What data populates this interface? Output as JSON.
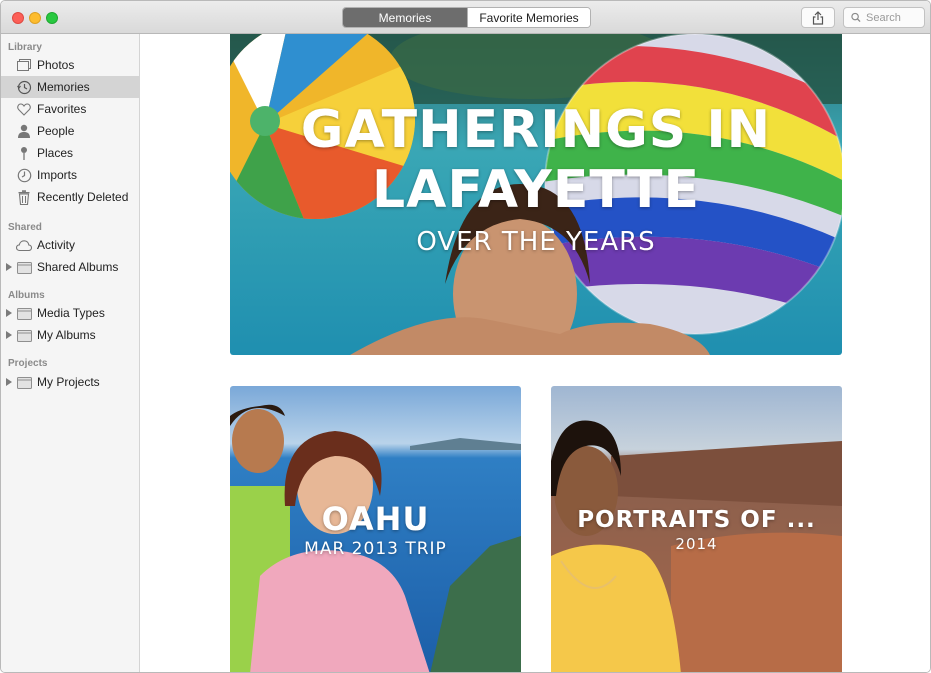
{
  "toolbar": {
    "tabs": [
      {
        "label": "Memories",
        "selected": true
      },
      {
        "label": "Favorite Memories",
        "selected": false
      }
    ],
    "search_placeholder": "Search",
    "share_icon": "share-icon"
  },
  "sidebar": {
    "sections": {
      "library": "Library",
      "shared": "Shared",
      "albums": "Albums",
      "projects": "Projects"
    },
    "items": [
      {
        "label": "Photos",
        "icon": "photos-icon"
      },
      {
        "label": "Memories",
        "icon": "memories-icon",
        "selected": true
      },
      {
        "label": "Favorites",
        "icon": "heart-icon"
      },
      {
        "label": "People",
        "icon": "person-icon"
      },
      {
        "label": "Places",
        "icon": "pin-icon"
      },
      {
        "label": "Imports",
        "icon": "clock-icon"
      },
      {
        "label": "Recently Deleted",
        "icon": "trash-icon"
      },
      {
        "label": "Activity",
        "icon": "cloud-icon"
      },
      {
        "label": "Shared Albums",
        "icon": "folder-icon"
      },
      {
        "label": "Media Types",
        "icon": "folder-icon"
      },
      {
        "label": "My Albums",
        "icon": "folder-icon"
      },
      {
        "label": "My Projects",
        "icon": "folder-icon"
      }
    ]
  },
  "memories": [
    {
      "title_line1": "Gatherings in",
      "title_line2": "Lafayette",
      "subtitle": "OVER THE YEARS"
    },
    {
      "title": "OAHU",
      "subtitle": "MAR 2013 TRIP"
    },
    {
      "title": "PORTRAITS OF ...",
      "subtitle": "2014"
    }
  ],
  "colors": {
    "accent_selected_tab": "#6d6d6d",
    "sidebar_bg": "#f5f5f5",
    "sidebar_selected": "#d4d4d4"
  }
}
